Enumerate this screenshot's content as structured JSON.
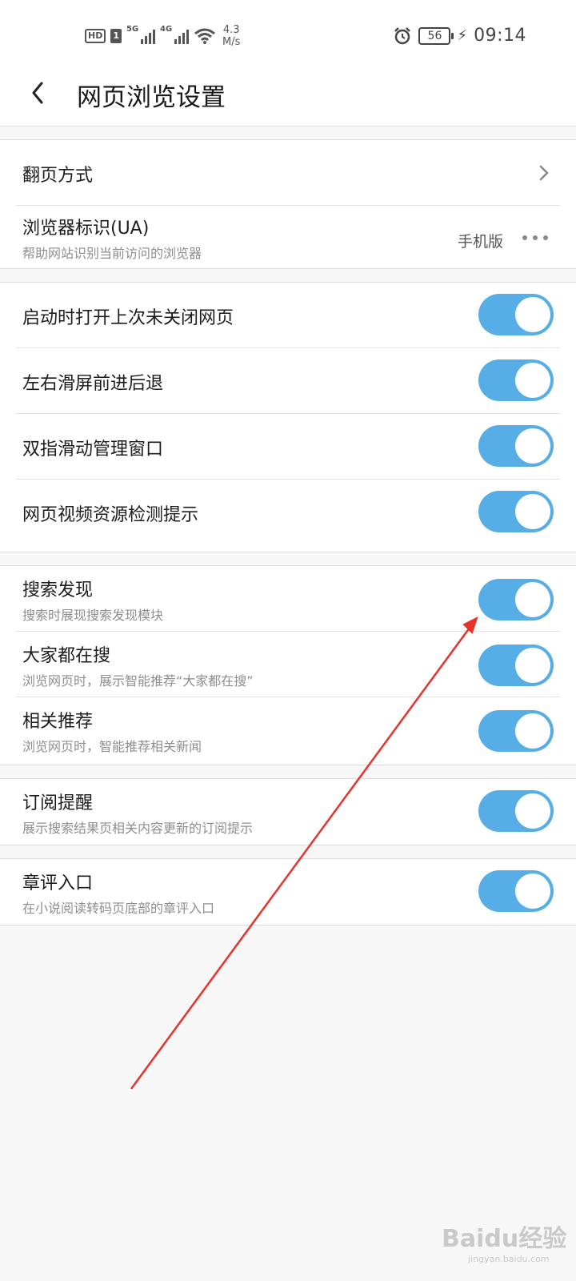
{
  "status_bar": {
    "hd": "HD",
    "sim": "1",
    "net1": "5G",
    "net2": "4G",
    "speed_value": "4.3",
    "speed_unit": "M/s",
    "battery": "56",
    "time": "09:14",
    "icons": [
      "alarm-icon",
      "wifi-icon",
      "signal-icon",
      "battery-icon",
      "charging-icon"
    ]
  },
  "header": {
    "title": "网页浏览设置",
    "back_icon": "back-arrow-icon"
  },
  "group1": {
    "page_turn": {
      "label": "翻页方式",
      "icon": "chevron-right-icon"
    },
    "ua": {
      "label": "浏览器标识(UA)",
      "sub": "帮助网站识别当前访问的浏览器",
      "value": "手机版",
      "icon": "more-dots-icon"
    }
  },
  "group2": {
    "items": [
      {
        "label": "启动时打开上次未关闭网页",
        "on": true
      },
      {
        "label": "左右滑屏前进后退",
        "on": true
      },
      {
        "label": "双指滑动管理窗口",
        "on": true
      },
      {
        "label": "网页视频资源检测提示",
        "on": true
      }
    ]
  },
  "group3": {
    "items": [
      {
        "label": "搜索发现",
        "sub": "搜索时展现搜索发现模块",
        "on": true
      },
      {
        "label": "大家都在搜",
        "sub": "浏览网页时，展示智能推荐“大家都在搜”",
        "on": true
      },
      {
        "label": "相关推荐",
        "sub": "浏览网页时，智能推荐相关新闻",
        "on": true
      }
    ]
  },
  "group4": {
    "items": [
      {
        "label": "订阅提醒",
        "sub": "展示搜索结果页相关内容更新的订阅提示",
        "on": true
      }
    ]
  },
  "group5": {
    "items": [
      {
        "label": "章评入口",
        "sub": "在小说阅读转码页底部的章评入口",
        "on": true
      }
    ]
  },
  "watermark": {
    "text": "Baidu经验",
    "sub": "jingyan.baidu.com"
  },
  "colors": {
    "toggle_on": "#57ade6",
    "annotation_arrow": "#e8322b",
    "background": "#f7f7f7"
  }
}
